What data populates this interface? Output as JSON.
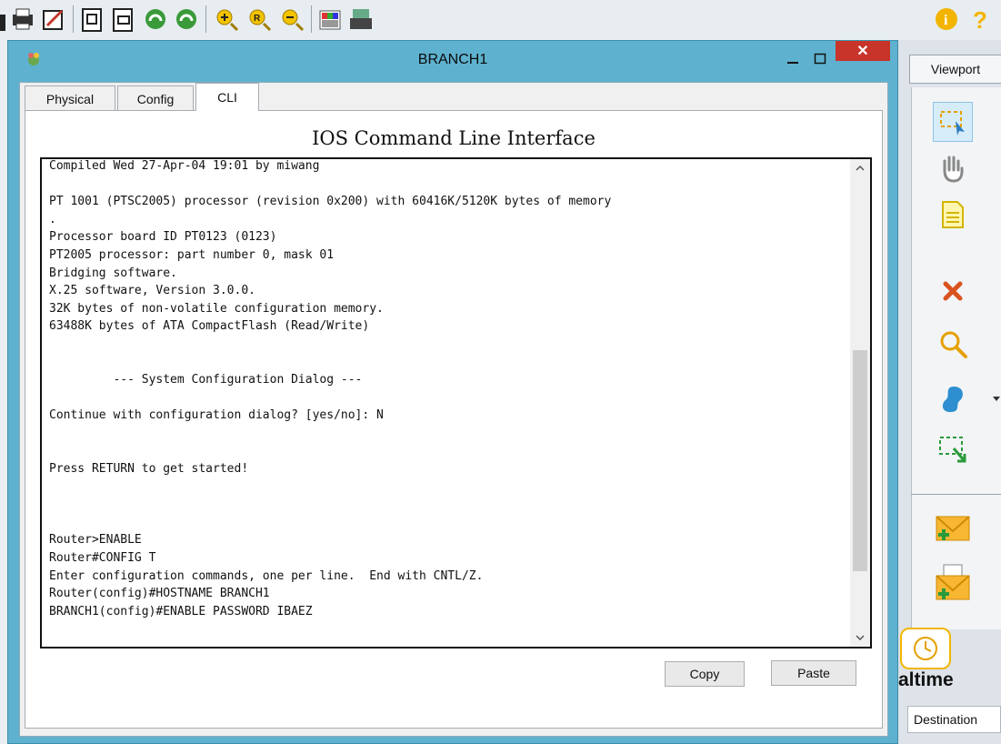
{
  "window": {
    "title": "BRANCH1",
    "close_symbol": "✕"
  },
  "tabs": [
    {
      "label": "Physical"
    },
    {
      "label": "Config"
    },
    {
      "label": "CLI"
    }
  ],
  "cli": {
    "heading": "IOS Command Line Interface",
    "lines": [
      "Compiled Wed 27-Apr-04 19:01 by miwang",
      "",
      "PT 1001 (PTSC2005) processor (revision 0x200) with 60416K/5120K bytes of memory",
      ".",
      "Processor board ID PT0123 (0123)",
      "PT2005 processor: part number 0, mask 01",
      "Bridging software.",
      "X.25 software, Version 3.0.0.",
      "32K bytes of non-volatile configuration memory.",
      "63488K bytes of ATA CompactFlash (Read/Write)",
      "",
      "",
      "         --- System Configuration Dialog ---",
      "",
      "Continue with configuration dialog? [yes/no]: N",
      "",
      "",
      "Press RETURN to get started!",
      "",
      "",
      "",
      "Router>ENABLE",
      "Router#CONFIG T",
      "Enter configuration commands, one per line.  End with CNTL/Z.",
      "Router(config)#HOSTNAME BRANCH1",
      "BRANCH1(config)#ENABLE PASSWORD IBAEZ"
    ],
    "copy_label": "Copy",
    "paste_label": "Paste",
    "scroll_position": 0.75
  },
  "side_panel": {
    "viewport_label": "Viewport",
    "realtime_label": "altime",
    "destination_label": "Destination",
    "tools": [
      "select-icon",
      "hand-icon",
      "note-icon",
      "delete-icon",
      "inspect-icon",
      "draw-shape-icon",
      "resize-icon",
      "add-simple-pdu-icon",
      "add-complex-pdu-icon"
    ]
  },
  "toolbar": {
    "icons": [
      "save-icon",
      "print-icon",
      "activity-wizard-icon",
      "copy-icon",
      "paste-icon",
      "undo-icon",
      "redo-icon",
      "zoom-in-icon",
      "zoom-reset-icon",
      "zoom-out-icon",
      "palette-icon",
      "custom-device-icon",
      "info-icon",
      "help-icon"
    ]
  },
  "colors": {
    "window_frame": "#5eb2cf",
    "close_button": "#c8342a",
    "select_tool_bg": "#d7ecf9"
  }
}
